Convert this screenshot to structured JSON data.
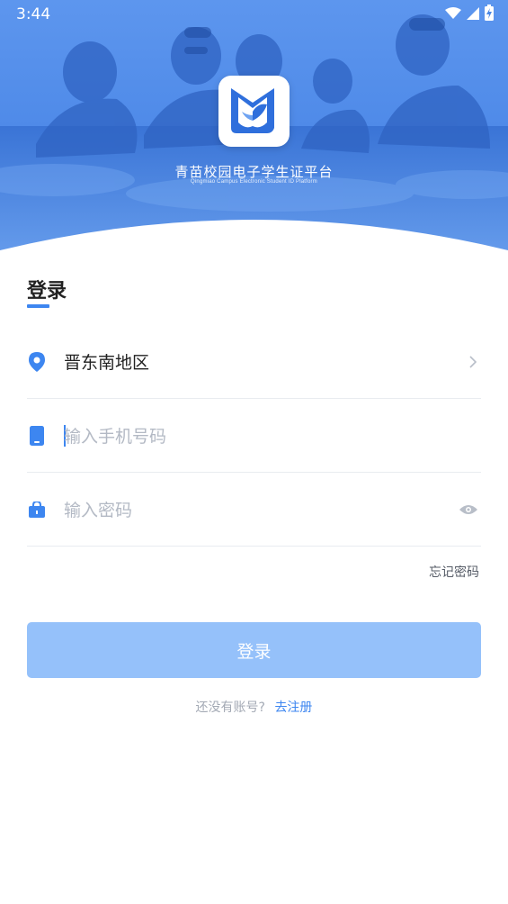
{
  "status_bar": {
    "time": "3:44"
  },
  "brand": {
    "name_cn": "青苗校园电子学生证平台",
    "name_en": "Qingmiao Campus Electronic Student ID Platform"
  },
  "login": {
    "title": "登录",
    "region": "晋东南地区",
    "phone_placeholder": "输入手机号码",
    "password_placeholder": "输入密码",
    "forgot_password": "忘记密码",
    "submit_label": "登录",
    "no_account_text": "还没有账号?",
    "register_link": "去注册"
  },
  "colors": {
    "accent": "#3d86f0",
    "button_disabled": "#95c1fa",
    "hero_blue": "#4a86e4"
  },
  "icons": {
    "region": "location-pin-icon",
    "phone": "phone-icon",
    "password": "lock-icon",
    "visibility": "eye-icon",
    "chevron": "chevron-right-icon"
  }
}
